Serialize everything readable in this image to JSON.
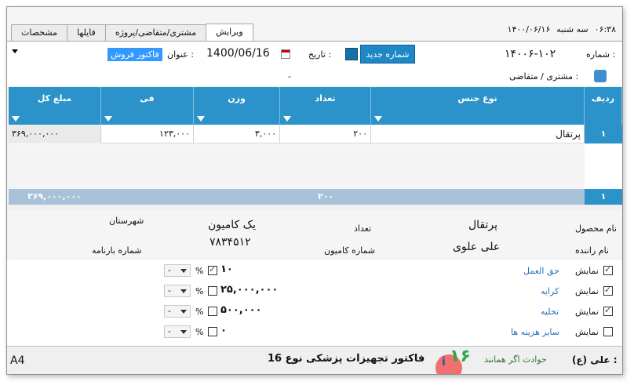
{
  "window": {
    "clock": {
      "time": "۰۶:۳۸",
      "weekday": "سه شنبه",
      "date": "۱۴۰۰/۰۶/۱۶"
    },
    "tabs": [
      {
        "label": "ویرایش",
        "active": true
      },
      {
        "label": "مشتری/متقاضی/پروژه",
        "active": false
      },
      {
        "label": "فایلها",
        "active": false
      },
      {
        "label": "مشخصات",
        "active": false
      }
    ]
  },
  "form": {
    "number_label": "شماره :",
    "number_value": "۱۴۰۰۶-۱۰۲",
    "new_number_button": "شماره جدید",
    "date_label": "تاریخ :",
    "date_value": "1400/06/16",
    "title_label": "عنوان :",
    "title_value": "فاکتور فروش",
    "customer_label": "مشتری / متقاضی :",
    "customer_value": "-"
  },
  "grid": {
    "columns": [
      "ردیف",
      "نوع جنس",
      "تعداد",
      "وزن",
      "فی",
      "مبلغ کل"
    ],
    "rows": [
      {
        "index": "۱",
        "item": "پرتقال",
        "qty": "۲۰۰",
        "weight": "۳,۰۰۰",
        "price": "۱۲۳,۰۰۰",
        "total": "۳۶۹,۰۰۰,۰۰۰"
      }
    ],
    "footer": {
      "index": "۱",
      "qty": "۲۰۰",
      "total": "۳۶۹,۰۰۰,۰۰۰"
    }
  },
  "detail": {
    "product_label": "نام محصول",
    "product_value": "پرتقال",
    "count_label": "تعداد",
    "count_value": "یک کامیون",
    "city_label": "شهرستان",
    "driver_label": "نام راننده",
    "driver_value": "علی علوی",
    "truck_no_label": "شماره کامیون",
    "truck_no_value": "۷۸۳۴۵۱۲",
    "waybill_label": "شماره بارنامه"
  },
  "costs": {
    "show_label": "نمایش",
    "pct_symbol": "%",
    "dash": "-",
    "items": [
      {
        "name": "حق العمل",
        "show": true,
        "pct_checked": true,
        "amount": "۱۰"
      },
      {
        "name": "کرایه",
        "show": true,
        "pct_checked": false,
        "amount": "۲۵,۰۰۰,۰۰۰"
      },
      {
        "name": "تخلیه",
        "show": true,
        "pct_checked": false,
        "amount": "۵۰۰,۰۰۰"
      },
      {
        "name": "سایر هزینه ها",
        "show": false,
        "pct_checked": false,
        "amount": "۰"
      }
    ]
  },
  "status": {
    "user": "علی (ع) :",
    "note": "حوادث اگر همانند",
    "app_title": "فاکتور تجهیزات پزشکی نوع 16",
    "paper": "A4"
  }
}
